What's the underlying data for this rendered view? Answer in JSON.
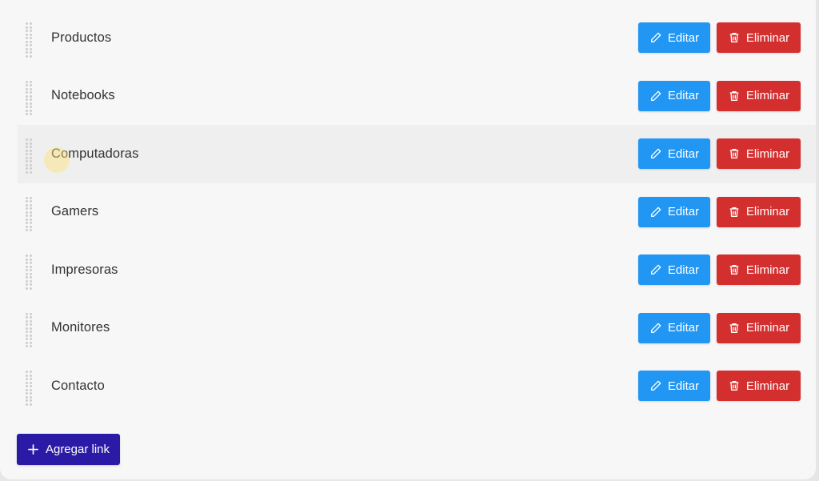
{
  "colors": {
    "edit": "#2196f3",
    "delete": "#d32f2f",
    "add": "#2b1aa6"
  },
  "links": [
    {
      "label": "Productos",
      "edit_label": "Editar",
      "delete_label": "Eliminar"
    },
    {
      "label": "Notebooks",
      "edit_label": "Editar",
      "delete_label": "Eliminar"
    },
    {
      "label": "Computadoras",
      "edit_label": "Editar",
      "delete_label": "Eliminar"
    },
    {
      "label": "Gamers",
      "edit_label": "Editar",
      "delete_label": "Eliminar"
    },
    {
      "label": "Impresoras",
      "edit_label": "Editar",
      "delete_label": "Eliminar"
    },
    {
      "label": "Monitores",
      "edit_label": "Editar",
      "delete_label": "Eliminar"
    },
    {
      "label": "Contacto",
      "edit_label": "Editar",
      "delete_label": "Eliminar"
    }
  ],
  "icons": {
    "handle": "drag-handle-icon",
    "edit": "pencil-icon",
    "delete": "trash-icon",
    "add": "plus-icon"
  },
  "add_button": {
    "label": "Agregar link"
  }
}
